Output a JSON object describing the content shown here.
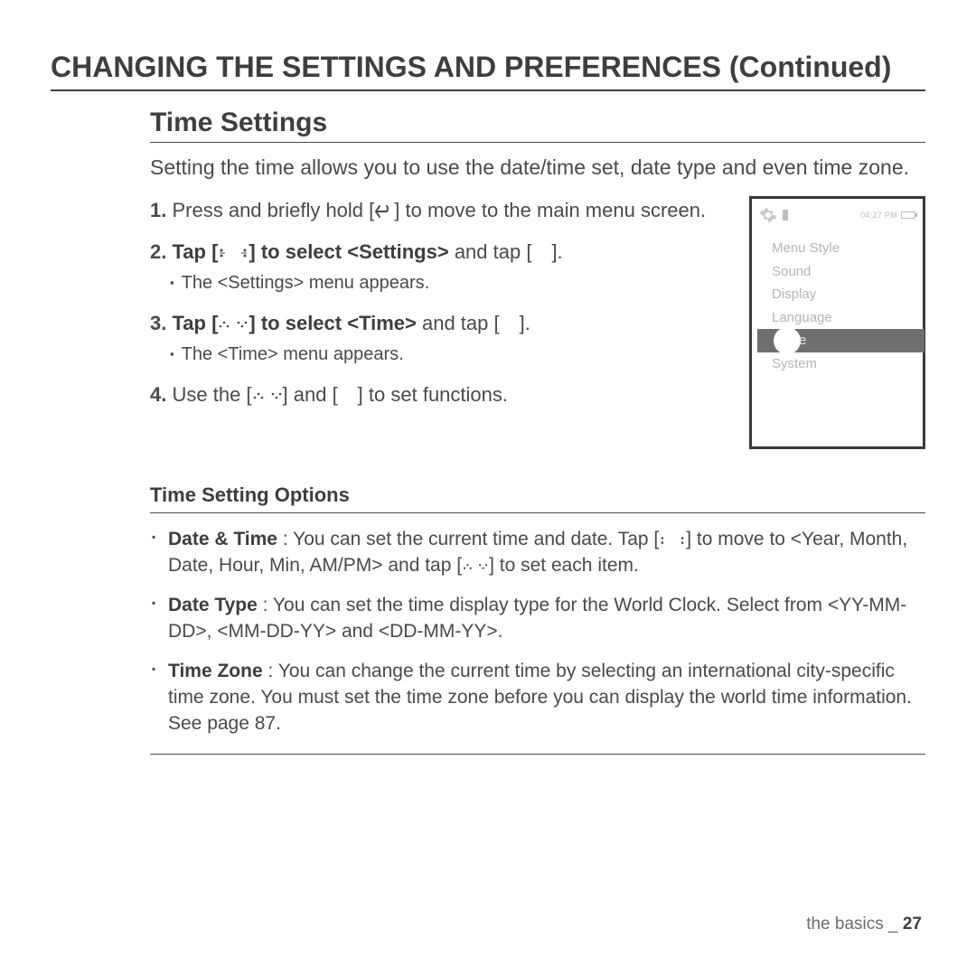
{
  "mainTitle": "CHANGING THE SETTINGS AND PREFERENCES (Continued)",
  "sectionTitle": "Time Settings",
  "intro": "Setting the time allows you to use the date/time set, date type and even time zone.",
  "step1a": "Press and briefly hold [",
  "step1b": "] to move to the main menu screen.",
  "step2a": "Tap [",
  "step2b": "] to select ",
  "step2c": "<Settings>",
  "step2d": " and tap [ ].",
  "step2sub": "The <Settings> menu appears.",
  "step3a": "Tap [",
  "step3b": "] to select ",
  "step3c": "<Time>",
  "step3d": " and tap [ ].",
  "step3sub": "The <Time> menu appears.",
  "step4a": "Use the [",
  "step4b": "] and [ ] to set functions.",
  "device": {
    "time": "04:27 PM",
    "items": [
      "Menu Style",
      "Sound",
      "Display",
      "Language"
    ],
    "selected": "e",
    "after": "System"
  },
  "optionsTitle": "Time Setting Options",
  "opt1Label": "Date & Time",
  "opt1a": " : You can set the current time and date. Tap [",
  "opt1b": "] to move to <Year, Month, Date, Hour, Min, AM/PM> and tap [",
  "opt1c": "] to set each item.",
  "opt2Label": "Date Type",
  "opt2": " : You can set the time display type for the World Clock. Select from <YY-MM-DD>, <MM-DD-YY> and <DD-MM-YY>.",
  "opt3Label": "Time Zone",
  "opt3": " : You can change the current time by selecting an international city-specific time zone. You must set the time zone before you can display the world time information. See page 87.",
  "footerText": "the basics _ ",
  "pageNum": "27"
}
